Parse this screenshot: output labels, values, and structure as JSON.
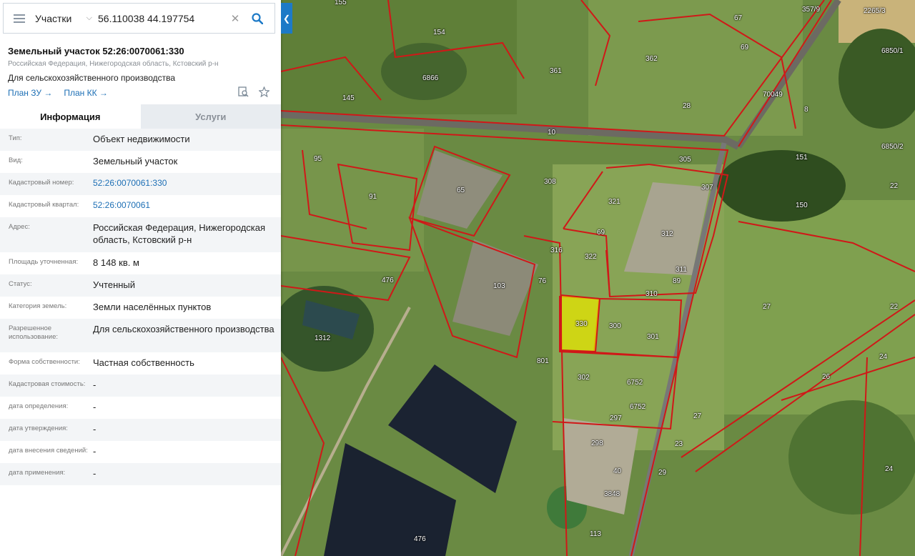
{
  "search": {
    "layer": "Участки",
    "query": "56.110038 44.197754"
  },
  "parcel": {
    "title": "Земельный участок 52:26:0070061:330",
    "address_short": "Российская Федерация, Нижегородская область, Кстовский р-н",
    "purpose": "Для сельскохозяйственного производства",
    "plan_zu": "План ЗУ →",
    "plan_kk": "План КК →"
  },
  "tabs": {
    "info": "Информация",
    "services": "Услуги"
  },
  "info_rows": [
    {
      "label": "Тип:",
      "value": "Объект недвижимости"
    },
    {
      "label": "Вид:",
      "value": "Земельный участок"
    },
    {
      "label": "Кадастровый номер:",
      "value": "52:26:0070061:330"
    },
    {
      "label": "Кадастровый квартал:",
      "value": "52:26:0070061"
    },
    {
      "label": "Адрес:",
      "value": "Российская Федерация, Нижегородская область, Кстовский р-н"
    },
    {
      "label": "Площадь уточненная:",
      "value": "8 148 кв. м"
    },
    {
      "label": "Статус:",
      "value": "Учтенный"
    },
    {
      "label": "Категория земель:",
      "value": "Земли населённых пунктов"
    },
    {
      "label": "Разрешенное использование:",
      "value": "Для сельскохозяйственного производства"
    },
    {
      "label": "Форма собственности:",
      "value": "Частная собственность"
    },
    {
      "label": "Кадастровая стоимость:",
      "value": "-"
    },
    {
      "label": "дата определения:",
      "value": "-"
    },
    {
      "label": "дата утверждения:",
      "value": "-"
    },
    {
      "label": "дата внесения сведений:",
      "value": "-"
    },
    {
      "label": "дата применения:",
      "value": "-"
    }
  ],
  "map": {
    "labels": [
      "155",
      "154",
      "361",
      "362",
      "67",
      "69",
      "357/9",
      "2265/3",
      "6850/1",
      "6866",
      "145",
      "70049",
      "28",
      "8",
      "10",
      "6850/2",
      "95",
      "65",
      "308",
      "305",
      "307",
      "151",
      "22",
      "91",
      "321",
      "150",
      "312",
      "69",
      "322",
      "311",
      "316",
      "476",
      "103",
      "76",
      "89",
      "310",
      "27",
      "330",
      "300",
      "301",
      "22",
      "1312",
      "801",
      "302",
      "6752",
      "26",
      "24",
      "6752",
      "27",
      "297",
      "298",
      "23",
      "40",
      "29",
      "24",
      "3848",
      "113",
      "476"
    ],
    "colors": {
      "boundary": "#d01818",
      "selected_fill": "#e6e600",
      "accent": "#1d7ac7"
    }
  }
}
